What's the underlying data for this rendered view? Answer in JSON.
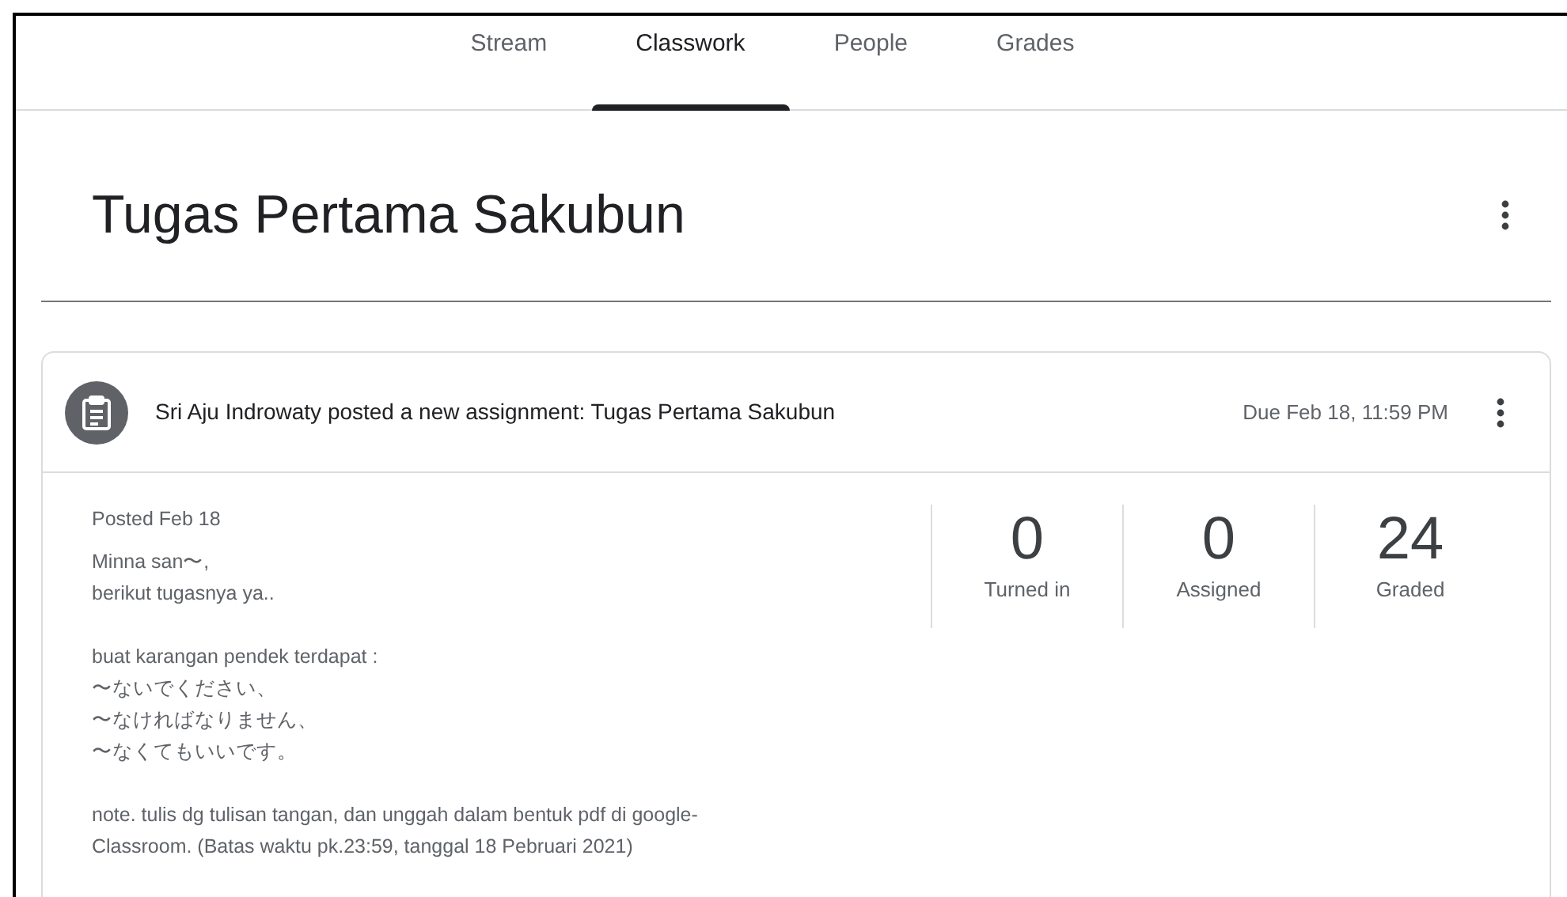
{
  "tabs": [
    {
      "label": "Stream",
      "selected": false
    },
    {
      "label": "Classwork",
      "selected": true
    },
    {
      "label": "People",
      "selected": false
    },
    {
      "label": "Grades",
      "selected": false
    }
  ],
  "title": "Tugas Pertama Sakubun",
  "post": {
    "header": "Sri Aju Indrowaty posted a new assignment: Tugas Pertama Sakubun",
    "due": "Due Feb 18, 11:59 PM",
    "posted": "Posted Feb 18",
    "paragraphs": [
      [
        "Minna san〜,",
        "berikut tugasnya ya.."
      ],
      [
        "buat karangan pendek terdapat :",
        "〜ないでください、",
        "〜なければなりません、",
        "〜なくてもいいです。"
      ],
      [
        "note. tulis dg tulisan tangan, dan unggah dalam bentuk pdf di google-",
        "Classroom. (Batas waktu pk.23:59, tanggal 18 Pebruari 2021)"
      ]
    ],
    "stats": [
      {
        "value": "0",
        "label": "Turned in"
      },
      {
        "value": "0",
        "label": "Assigned"
      },
      {
        "value": "24",
        "label": "Graded"
      }
    ]
  }
}
